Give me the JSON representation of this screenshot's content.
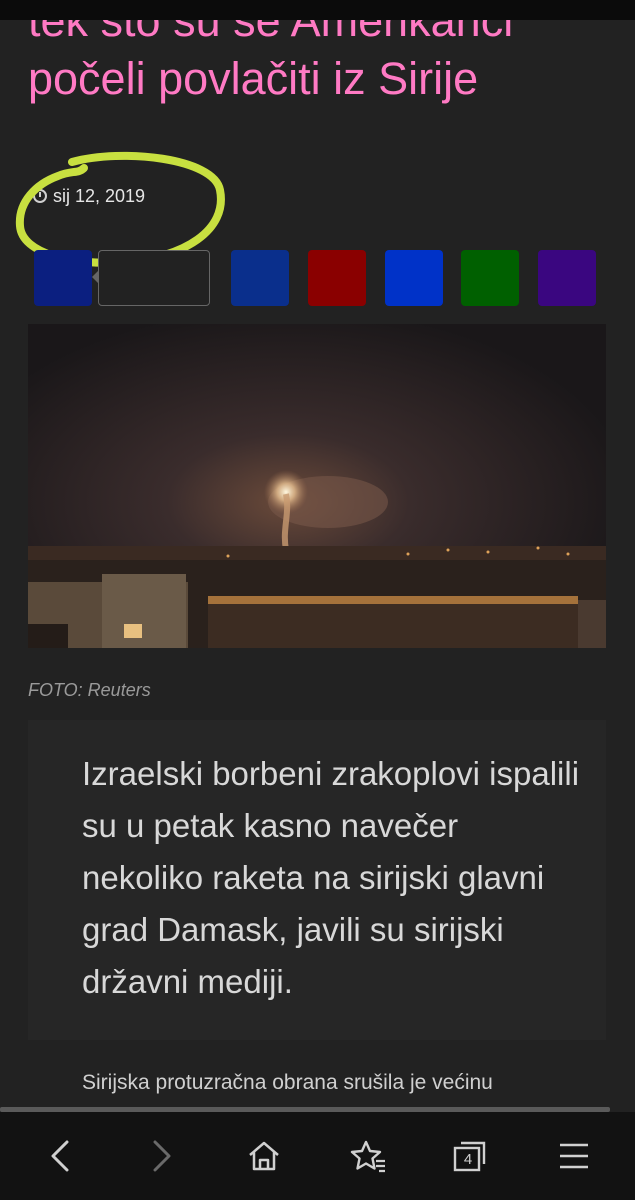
{
  "article": {
    "headline": "tek što su se Amerikanci počeli povlačiti iz Sirije",
    "date": "sij 12, 2019",
    "photo_caption": "FOTO: Reuters",
    "lead": "Izraelski borbeni zrakoplovi ispalili su u petak kasno navečer nekoliko raketa na sirijski glavni grad Damask, javili su sirijski državni mediji.",
    "body_first_line": "Sirijska protuzračna obrana srušila je većinu"
  },
  "share_buttons": [
    {
      "color": "#0b1f80",
      "icon": "facebook-share"
    },
    {
      "color": "#0a2f8c",
      "icon": "twitter-share"
    },
    {
      "color": "#8a0000",
      "icon": "google-share"
    },
    {
      "color": "#0032c8",
      "icon": "linkedin-share"
    },
    {
      "color": "#006000",
      "icon": "whatsapp-share"
    },
    {
      "color": "#3a0680",
      "icon": "viber-share"
    }
  ],
  "annotation": {
    "color": "#c8e040"
  },
  "colors": {
    "headline": "#ff7ac4",
    "background": "#222222"
  },
  "navbar": {
    "tabs_count": "4",
    "icons": [
      "back-icon",
      "forward-icon",
      "home-icon",
      "bookmark-star-icon",
      "tabs-icon",
      "menu-icon"
    ]
  }
}
